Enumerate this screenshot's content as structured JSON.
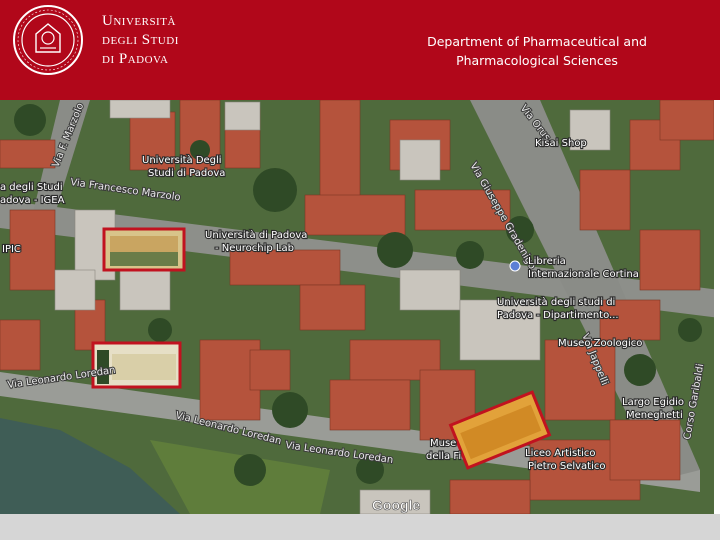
{
  "header": {
    "university_lines": [
      "Università",
      "degli Studi",
      "di Padova"
    ],
    "department_lines": [
      "Department of Pharmaceutical and",
      "Pharmacological Sciences"
    ],
    "brand_color": "#b1071a"
  },
  "map": {
    "labels": {
      "univ_padova": [
        "Università Degli",
        "Studi di Padova"
      ],
      "degli_studi_igea": [
        "a degli Studi",
        "adova - IGEA"
      ],
      "ipic": "IPIC",
      "neurochip": [
        "Università di Padova",
        "- Neurochip Lab"
      ],
      "libreria": [
        "Libreria",
        "Internazionale Cortina"
      ],
      "kisai": "Kisai Shop",
      "dipartimento": [
        "Università degli studi di",
        "Padova - Dipartimento..."
      ],
      "museo_zoologico": "Museo Zoologico",
      "largo": [
        "Largo Egidio",
        "Meneghetti"
      ],
      "liceo": [
        "Liceo Artistico",
        "Pietro Selvatico"
      ],
      "museo_fi": [
        "Muse",
        "della Fi"
      ]
    },
    "streets": {
      "marzolo_left": "Via F. Marzolo",
      "marzolo": "Via Francesco Marzolo",
      "loredan_1": "Via Leonardo Loredan",
      "loredan_2": "Via Leonardo Loredan",
      "loredan_3": "Via Leonardo Loredan",
      "gradenigo": "Via Giuseppe Gradenigo",
      "orus": "Via Orus",
      "jappelli": "Via Jappelli",
      "cornaro": "Corso Garibaldi"
    },
    "attribution": "Google",
    "highlight_color": "#c1121f"
  }
}
